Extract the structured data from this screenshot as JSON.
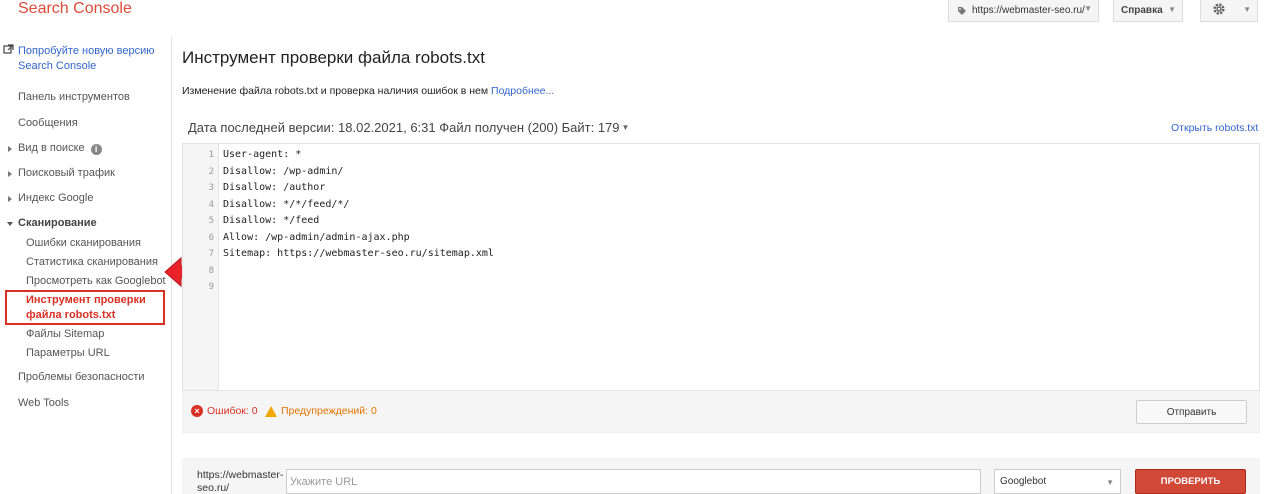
{
  "header": {
    "brand": "Search Console",
    "site": "https://webmaster-seo.ru/",
    "help_label": "Справка"
  },
  "sidebar": {
    "promo": [
      "Попробуйте новую версию",
      "Search Console"
    ],
    "items": [
      {
        "label": "Панель инструментов"
      },
      {
        "label": "Сообщения"
      },
      {
        "label": "Вид в поиске"
      },
      {
        "label": "Поисковый трафик"
      },
      {
        "label": "Индекс Google"
      },
      {
        "label": "Сканирование"
      }
    ],
    "sub_items": [
      {
        "label": "Ошибки сканирования"
      },
      {
        "label": "Статистика сканирования"
      },
      {
        "label": "Просмотреть как Googlebot"
      },
      {
        "label": "Файлы Sitemap"
      },
      {
        "label": "Параметры URL"
      }
    ],
    "active_item": [
      "Инструмент проверки",
      "файла robots.txt"
    ],
    "bottom_items": [
      {
        "label": "Проблемы безопасности"
      },
      {
        "label": "Web Tools"
      }
    ]
  },
  "main": {
    "title": "Инструмент проверки файла robots.txt",
    "description": "Изменение файла robots.txt и проверка наличия ошибок в нем",
    "more_link": "Подробнее...",
    "version_info": "Дата последней версии: 18.02.2021, 6:31 Файл получен (200) Байт: 179",
    "open_link": "Открыть robots.txt",
    "code_lines": [
      "User-agent: *",
      "Disallow: /wp-admin/",
      "Disallow: /author",
      "Disallow: */*/feed/*/",
      "Disallow: */feed",
      "Allow: /wp-admin/admin-ajax.php",
      "Sitemap: https://webmaster-seo.ru/sitemap.xml",
      "",
      ""
    ],
    "line_numbers": [
      "1",
      "2",
      "3",
      "4",
      "5",
      "6",
      "7",
      "8",
      "9"
    ],
    "errors_label": "Ошибок: 0",
    "warnings_label": "Предупреждений: 0",
    "submit_label": "Отправить",
    "test_url_label": [
      "https://webmaster-",
      "seo.ru/"
    ],
    "test_url_placeholder": "Укажите URL",
    "bot_selected": "Googlebot",
    "check_label": "ПРОВЕРИТЬ"
  },
  "colors": {
    "brand": "#dd4b39",
    "link": "#3366cc",
    "active": "#d93025",
    "check_button": "#d14836",
    "warning": "#e37400"
  },
  "icons": [
    "tag-icon",
    "gear-icon",
    "external-link-icon",
    "info-icon",
    "error-icon",
    "warning-icon",
    "red-arrow-icon"
  ]
}
